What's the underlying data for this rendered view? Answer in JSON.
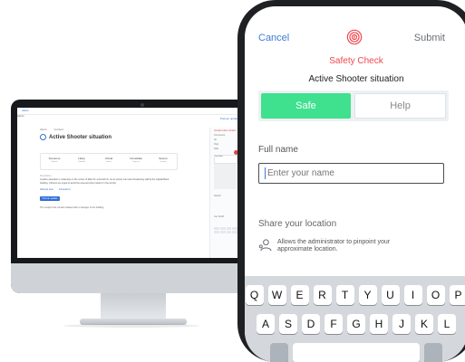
{
  "desktop": {
    "back_label": "Alerts",
    "alerts_label": "Alerts",
    "top_link": "Post an update",
    "breadcrumb": [
      "Alerts",
      "Incident"
    ],
    "title": "Active Shooter situation",
    "cards": [
      {
        "label": "Someone",
        "sub": "Reports"
      },
      {
        "label": "Likely",
        "sub": "Probable"
      },
      {
        "label": "Actual",
        "sub": "Status"
      },
      {
        "label": "Immediate",
        "sub": "Urgency"
      },
      {
        "label": "Severe",
        "sub": "Severity"
      }
    ],
    "description_label": "Description",
    "description": "A police operation is underway on the corner of Main St. and Addr St. as an armed man was threatening staff at the Capital Bank building. Citizens are urged to avoid the area and stay inside if in the vicinity.",
    "tabs": [
      "Affected area",
      "Instructions"
    ],
    "post_button": "Post an update",
    "log_entry": "The suspect has contact initiated with a manager in the building.",
    "side_status": "Unsafe button clicked",
    "side_lines": [
      "Comments",
      "All",
      "Help",
      "Safe"
    ],
    "side_user": "Jay Smith",
    "side_user2": "Joe Smith",
    "side_search": "Search"
  },
  "mobile": {
    "cancel": "Cancel",
    "submit": "Submit",
    "fingerprint_icon": "fingerprint-icon",
    "title": "Safety Check",
    "subtitle": "Active Shooter situation",
    "segments": {
      "safe": "Safe",
      "help": "Help"
    },
    "full_name_label": "Full name",
    "full_name_placeholder": "Enter your name",
    "location_label": "Share your location",
    "location_icon": "person-pin-icon",
    "location_text": "Allows the administrator to pinpoint your approximate location.",
    "keyboard": {
      "row1": [
        "Q",
        "W",
        "E",
        "R",
        "T",
        "Y",
        "U",
        "I",
        "O",
        "P"
      ],
      "row2": [
        "A",
        "S",
        "D",
        "F",
        "G",
        "H",
        "J",
        "K",
        "L"
      ]
    }
  },
  "colors": {
    "accent": "#3e7bd8",
    "alert_red": "#f0474e",
    "safe_green": "#3fe08e"
  }
}
